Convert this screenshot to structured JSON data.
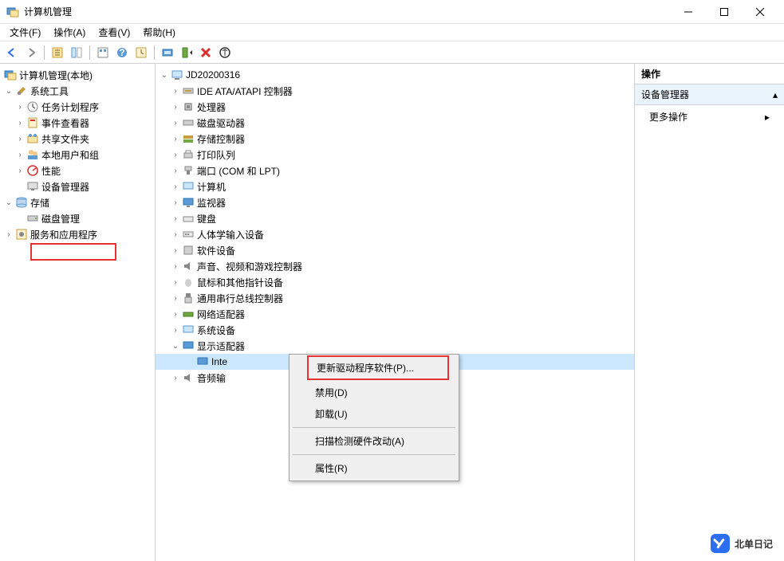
{
  "window": {
    "title": "计算机管理"
  },
  "menubar": {
    "file": "文件(F)",
    "action": "操作(A)",
    "view": "查看(V)",
    "help": "帮助(H)"
  },
  "left_tree": {
    "root": "计算机管理(本地)",
    "system_tools": "系统工具",
    "task_scheduler": "任务计划程序",
    "event_viewer": "事件查看器",
    "shared_folders": "共享文件夹",
    "local_users": "本地用户和组",
    "performance": "性能",
    "device_manager": "设备管理器",
    "storage": "存储",
    "disk_management": "磁盘管理",
    "services_apps": "服务和应用程序"
  },
  "center_tree": {
    "computer": "JD20200316",
    "ide": "IDE ATA/ATAPI 控制器",
    "processors": "处理器",
    "disk_drives": "磁盘驱动器",
    "storage_controllers": "存储控制器",
    "print_queues": "打印队列",
    "ports": "端口 (COM 和 LPT)",
    "computers": "计算机",
    "monitors": "监视器",
    "keyboards": "键盘",
    "hid": "人体学输入设备",
    "software_devices": "软件设备",
    "sound": "声音、视频和游戏控制器",
    "mice": "鼠标和其他指针设备",
    "usb": "通用串行总线控制器",
    "network": "网络适配器",
    "system_devices": "系统设备",
    "display_adapters": "显示适配器",
    "intel_graphics": "Inte",
    "audio_io": "音频输"
  },
  "context_menu": {
    "update_driver": "更新驱动程序软件(P)...",
    "disable": "禁用(D)",
    "uninstall": "卸载(U)",
    "scan_hw": "扫描检测硬件改动(A)",
    "properties": "属性(R)"
  },
  "actions_panel": {
    "header": "操作",
    "sub": "设备管理器",
    "more": "更多操作"
  },
  "watermark": "北单日记"
}
